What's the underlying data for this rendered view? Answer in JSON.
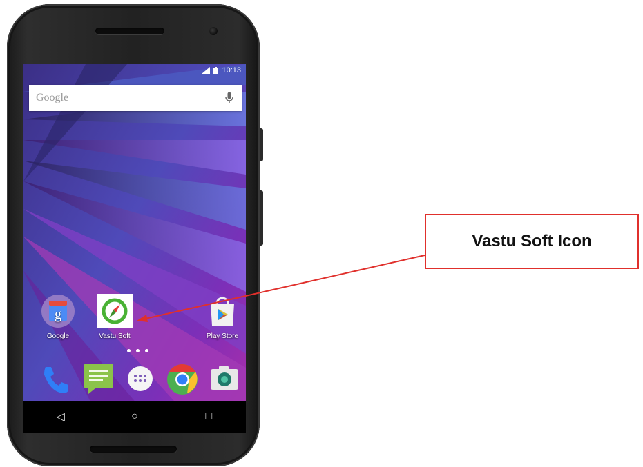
{
  "status_bar": {
    "time": "10:13"
  },
  "search": {
    "placeholder": "Google",
    "mic_icon": "microphone-icon"
  },
  "home_apps": [
    {
      "label": "Google",
      "icon": "google-search-app-icon"
    },
    {
      "label": "Vastu Soft",
      "icon": "compass-icon"
    },
    {
      "label": "Play Store",
      "icon": "play-store-icon"
    }
  ],
  "dock": [
    {
      "icon": "phone-icon"
    },
    {
      "icon": "messaging-icon"
    },
    {
      "icon": "app-drawer-icon"
    },
    {
      "icon": "chrome-icon"
    },
    {
      "icon": "camera-app-icon"
    }
  ],
  "nav": {
    "back": "◁",
    "home": "○",
    "recents": "□"
  },
  "callout": {
    "text": "Vastu Soft Icon"
  },
  "colors": {
    "callout_border": "#e0302c",
    "arrow": "#e0302c",
    "wallpaper_primary": "#5b3fb8"
  }
}
